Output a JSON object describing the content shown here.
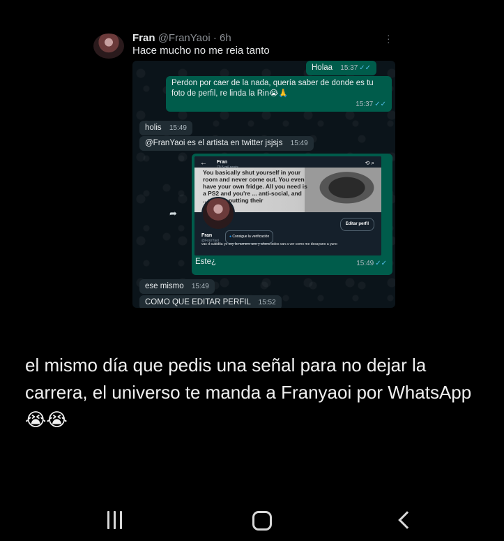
{
  "tweet": {
    "author_name": "Fran",
    "author_handle": "@FranYaoi",
    "separator": " · ",
    "age": "6h",
    "text": "Hace mucho no me reia tanto",
    "more_icon": "more-vertical-icon"
  },
  "chat": {
    "messages": [
      {
        "text": "Holaa",
        "time": "15:37",
        "direction": "out",
        "read": true
      },
      {
        "text": "Perdon por caer de la nada, quería saber de donde es tu foto de perfil, re linda la Rin😭🙏",
        "time": "15:37",
        "direction": "out",
        "read": true
      },
      {
        "text": "holis",
        "time": "15:49",
        "direction": "in"
      },
      {
        "text": "@FranYaoi es el artista en twitter jsjsjs",
        "time": "15:49",
        "direction": "in"
      },
      {
        "text": "Este¿",
        "time": "15:49",
        "direction": "out",
        "read": true
      },
      {
        "text": "ese mismo",
        "time": "15:49",
        "direction": "in"
      },
      {
        "text": "COMO QUE EDITAR PERFIL",
        "time": "15:52",
        "direction": "in"
      }
    ],
    "ticks_glyph": "✓✓",
    "forward_icon": "forward-icon",
    "screenshot": {
      "back_glyph": "←",
      "name": "Fran",
      "post_count": "79,5 mil posts",
      "icons": "⟲ ⌕",
      "banner_text": "You basically shut yourself in your room and never come out. You even have your own fridge. All you need is a PS2 and you're ... anti-social, and ...people putting their",
      "edit_button": "Editar perfil",
      "profile_name": "Fran",
      "profile_handle": "@FranYaoi",
      "verify_label": "Consigue la verificación",
      "bio": "vas d subidita yo soy la numero uno y ahora todos van a ver como me desayuno a yuno"
    }
  },
  "caption": "el mismo día que pedis una señal para no dejar la carrera, el universo te manda a Franyaoi por WhatsApp 😭😭",
  "nav": {
    "recents_icon": "recent-apps-icon",
    "home_icon": "home-icon",
    "back_icon": "back-icon"
  },
  "colors": {
    "background": "#000000",
    "chat_background": "#0b141a",
    "outgoing_bubble": "#005c4b",
    "incoming_bubble": "#202c33",
    "read_ticks": "#53bdeb"
  }
}
